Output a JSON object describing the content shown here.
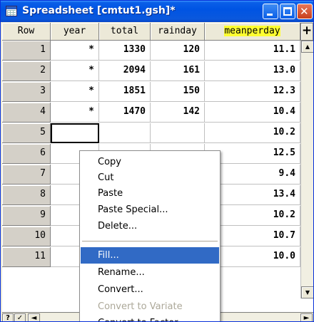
{
  "window": {
    "title": "Spreadsheet [cmtut1.gsh]*",
    "min_glyph": "",
    "max_glyph": "",
    "close_glyph": "✕"
  },
  "columns": [
    "Row",
    "year",
    "total",
    "rainday",
    "meanperday"
  ],
  "rows": [
    {
      "row": "1",
      "year": "*",
      "total": "1330",
      "rainday": "120",
      "meanperday": "11.1"
    },
    {
      "row": "2",
      "year": "*",
      "total": "2094",
      "rainday": "161",
      "meanperday": "13.0"
    },
    {
      "row": "3",
      "year": "*",
      "total": "1851",
      "rainday": "150",
      "meanperday": "12.3"
    },
    {
      "row": "4",
      "year": "*",
      "total": "1470",
      "rainday": "142",
      "meanperday": "10.4"
    },
    {
      "row": "5",
      "year": "",
      "total": "",
      "rainday": "",
      "meanperday": "10.2"
    },
    {
      "row": "6",
      "year": "",
      "total": "",
      "rainday": "",
      "meanperday": "12.5"
    },
    {
      "row": "7",
      "year": "",
      "total": "",
      "rainday": "",
      "meanperday": "9.4"
    },
    {
      "row": "8",
      "year": "",
      "total": "",
      "rainday": "",
      "meanperday": "13.4"
    },
    {
      "row": "9",
      "year": "",
      "total": "",
      "rainday": "",
      "meanperday": "10.2"
    },
    {
      "row": "10",
      "year": "",
      "total": "",
      "rainday": "",
      "meanperday": "10.7"
    },
    {
      "row": "11",
      "year": "",
      "total": "",
      "rainday": "",
      "meanperday": "10.0"
    }
  ],
  "toolbar": {
    "plus": "+",
    "scroll_up": "▲",
    "scroll_down": "▼",
    "scroll_left": "◄",
    "scroll_right": "►",
    "help": "?",
    "check": "✓"
  },
  "context_menu": {
    "items": [
      {
        "label": "Copy",
        "state": "normal"
      },
      {
        "label": "Cut",
        "state": "normal"
      },
      {
        "label": "Paste",
        "state": "normal"
      },
      {
        "label": "Paste Special...",
        "state": "normal"
      },
      {
        "label": "Delete...",
        "state": "normal"
      },
      {
        "label": "Fill...",
        "state": "highlighted"
      },
      {
        "label": "Rename...",
        "state": "normal"
      },
      {
        "label": "Convert...",
        "state": "normal"
      },
      {
        "label": "Convert to Variate",
        "state": "disabled"
      },
      {
        "label": "Convert to Factor",
        "state": "normal"
      }
    ]
  },
  "colors": {
    "titlebar": "#0054e3",
    "highlight_header": "#ffff30",
    "menu_highlight": "#316ac5",
    "disabled_text": "#aca899"
  }
}
